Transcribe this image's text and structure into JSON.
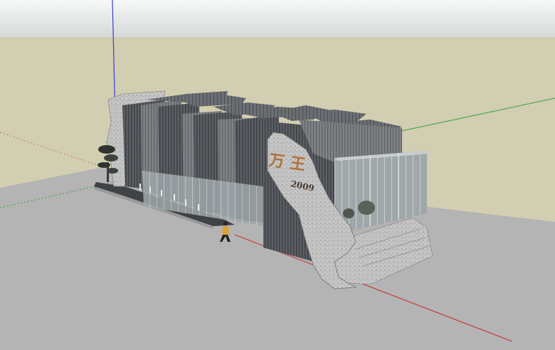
{
  "scene": {
    "sign": {
      "characters": "万 王",
      "year": "2009"
    },
    "colors": {
      "sky_top": "#f4f6f6",
      "sky_bottom": "#d9dcdc",
      "ground_far": "#d2ceb2",
      "ground_near": "#b2b2b2",
      "axis_blue": "#3b3bd6",
      "axis_green": "#2fa23a",
      "axis_red": "#c92b2b",
      "wall_dark": "#55585c",
      "wall_light": "#8b8e91",
      "rock": "#bdbdbd",
      "sign_text": "#b0713a"
    },
    "icons": [
      "axis-lines",
      "pine-tree",
      "person-figure",
      "rock-sign"
    ]
  }
}
